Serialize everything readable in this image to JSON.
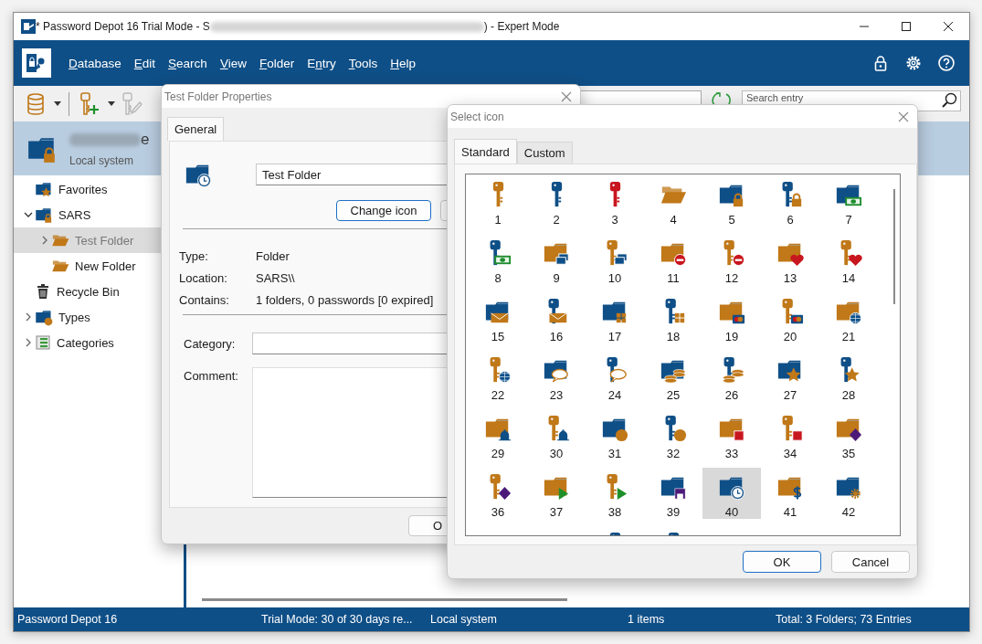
{
  "window": {
    "title_start": "* Password Depot 16 Trial Mode - S",
    "title_end": ") - Expert Mode"
  },
  "menu": [
    {
      "key": "D",
      "after": "atabase"
    },
    {
      "key": "E",
      "after": "dit"
    },
    {
      "key": "S",
      "after": "earch"
    },
    {
      "key": "V",
      "after": "iew"
    },
    {
      "key": "F",
      "after": "older"
    },
    {
      "before": "E",
      "key": "n",
      "after": "try"
    },
    {
      "key": "T",
      "after": "ools"
    },
    {
      "key": "H",
      "after": "elp"
    }
  ],
  "toolbar": {
    "search": {
      "placeholder": "Search entry"
    }
  },
  "database": {
    "name_end": "e",
    "location": "Local system"
  },
  "tree": [
    {
      "label": "Favorites",
      "expandable": false,
      "selected": false
    },
    {
      "label": "SARS",
      "expandable": true,
      "expanded": true,
      "selected": false,
      "children": [
        {
          "label": "Test Folder",
          "expandable": true,
          "expanded": false,
          "selected": true
        },
        {
          "label": "New Folder",
          "expandable": false,
          "selected": false
        }
      ]
    },
    {
      "label": "Recycle Bin",
      "expandable": false,
      "selected": false
    },
    {
      "label": "Types",
      "expandable": true,
      "expanded": false,
      "selected": false
    },
    {
      "label": "Categories",
      "expandable": true,
      "expanded": false,
      "selected": false
    }
  ],
  "status_bar": [
    "Password Depot 16",
    "Trial Mode: 30 of 30 days re...",
    "Local system",
    "1 items",
    "Total: 3 Folders; 73 Entries"
  ],
  "properties_dialog": {
    "title": "Test Folder Properties",
    "tabs": [
      {
        "label": "General",
        "selected": true
      }
    ],
    "name": "Test Folder",
    "change_icon_button": "Change icon",
    "fields": [
      {
        "label": "Type:",
        "value": "Folder"
      },
      {
        "label": "Location:",
        "value": "SARS\\\\"
      },
      {
        "label": "Contains:",
        "value": "1 folders, 0 passwords [0 expired]"
      }
    ],
    "category_label": "Category:",
    "comment_label": "Comment:",
    "ok_button": "O"
  },
  "icon_dialog": {
    "title": "Select icon",
    "tabs": [
      {
        "label": "Standard",
        "selected": true
      },
      {
        "label": "Custom",
        "selected": false
      }
    ],
    "icons": [
      {
        "label": "1",
        "selected": false
      },
      {
        "label": "2",
        "selected": false
      },
      {
        "label": "3",
        "selected": false
      },
      {
        "label": "4",
        "selected": false
      },
      {
        "label": "5",
        "selected": false
      },
      {
        "label": "6",
        "selected": false
      },
      {
        "label": "7",
        "selected": false
      },
      {
        "label": "8",
        "selected": false
      },
      {
        "label": "9",
        "selected": false
      },
      {
        "label": "10",
        "selected": false
      },
      {
        "label": "11",
        "selected": false
      },
      {
        "label": "12",
        "selected": false
      },
      {
        "label": "13",
        "selected": false
      },
      {
        "label": "14",
        "selected": false
      },
      {
        "label": "15",
        "selected": false
      },
      {
        "label": "16",
        "selected": false
      },
      {
        "label": "17",
        "selected": false
      },
      {
        "label": "18",
        "selected": false
      },
      {
        "label": "19",
        "selected": false
      },
      {
        "label": "20",
        "selected": false
      },
      {
        "label": "21",
        "selected": false
      },
      {
        "label": "22",
        "selected": false
      },
      {
        "label": "23",
        "selected": false
      },
      {
        "label": "24",
        "selected": false
      },
      {
        "label": "25",
        "selected": false
      },
      {
        "label": "26",
        "selected": false
      },
      {
        "label": "27",
        "selected": false
      },
      {
        "label": "28",
        "selected": false
      },
      {
        "label": "29",
        "selected": false
      },
      {
        "label": "30",
        "selected": false
      },
      {
        "label": "31",
        "selected": false
      },
      {
        "label": "32",
        "selected": false
      },
      {
        "label": "33",
        "selected": false
      },
      {
        "label": "34",
        "selected": false
      },
      {
        "label": "35",
        "selected": false
      },
      {
        "label": "36",
        "selected": false
      },
      {
        "label": "37",
        "selected": false
      },
      {
        "label": "38",
        "selected": false
      },
      {
        "label": "39",
        "selected": false
      },
      {
        "label": "40",
        "selected": true
      },
      {
        "label": "41",
        "selected": false
      },
      {
        "label": "42",
        "selected": false
      }
    ],
    "buttons": [
      "OK",
      "Cancel"
    ]
  }
}
